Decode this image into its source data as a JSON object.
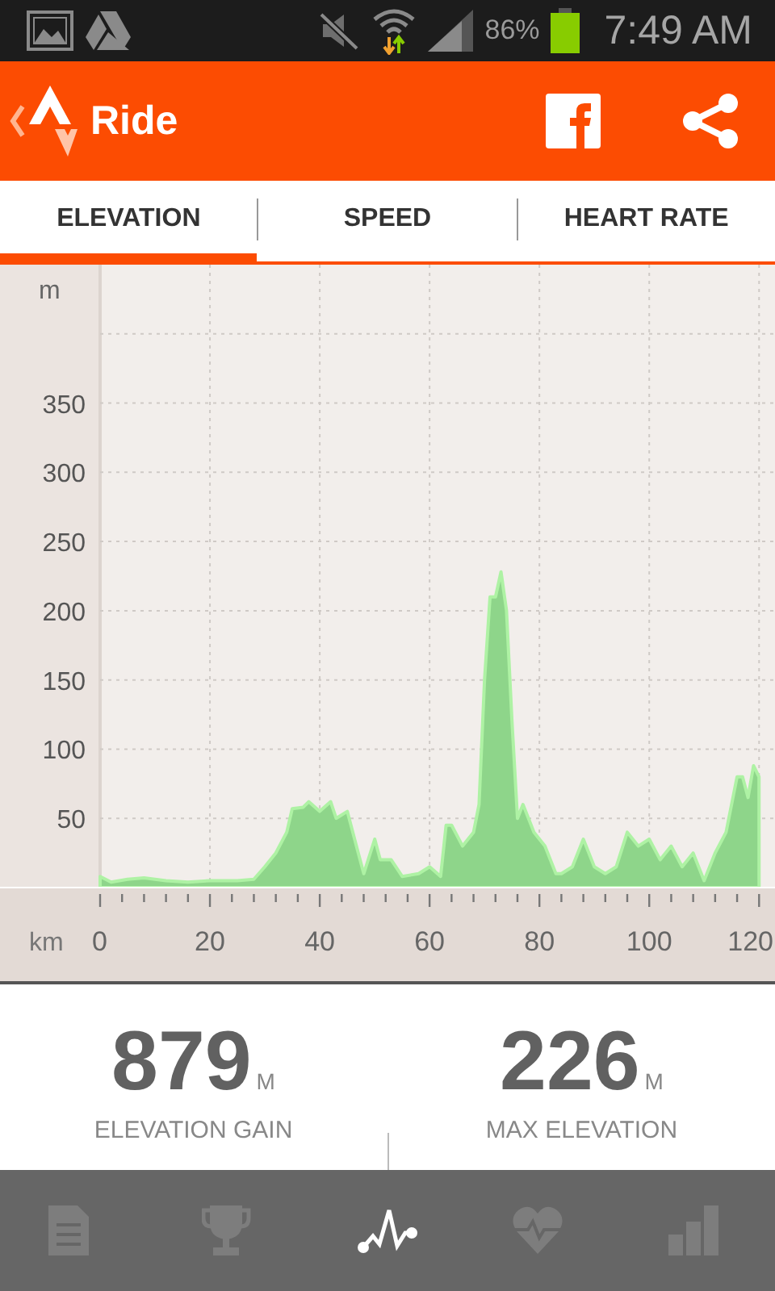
{
  "status_bar": {
    "battery": "86%",
    "time": "7:49 AM"
  },
  "header": {
    "title": "Ride"
  },
  "tabs": [
    {
      "label": "ELEVATION",
      "selected": true
    },
    {
      "label": "SPEED",
      "selected": false
    },
    {
      "label": "HEART RATE",
      "selected": false
    }
  ],
  "chart": {
    "chart_data": {
      "type": "area",
      "xlabel": "km",
      "ylabel": "m",
      "xlim": [
        0,
        122.9
      ],
      "ylim": [
        0,
        450
      ],
      "grid": true,
      "xticks": [
        0,
        20,
        40,
        60,
        80,
        100,
        120
      ],
      "yticks": [
        50,
        100,
        150,
        200,
        250,
        300,
        350
      ],
      "x": [
        0,
        2,
        5,
        8,
        12,
        16,
        20,
        25,
        28,
        30,
        32,
        34,
        35,
        37,
        38,
        40,
        42,
        43,
        45,
        47,
        48,
        50,
        51,
        53,
        55,
        58,
        60,
        62,
        63,
        64,
        66,
        68,
        69,
        70,
        71,
        72,
        73,
        74,
        75,
        76,
        77,
        79,
        81,
        83,
        84,
        86,
        88,
        90,
        92,
        94,
        96,
        98,
        100,
        102,
        104,
        106,
        108,
        110,
        112,
        114,
        116,
        117,
        118,
        119,
        120
      ],
      "series": [
        {
          "color": "#8ed58a",
          "values": [
            8,
            4,
            6,
            7,
            5,
            4,
            5,
            5,
            6,
            15,
            25,
            40,
            57,
            58,
            62,
            55,
            62,
            50,
            55,
            25,
            10,
            35,
            20,
            20,
            8,
            10,
            15,
            8,
            45,
            45,
            30,
            40,
            60,
            150,
            210,
            210,
            228,
            200,
            120,
            50,
            60,
            40,
            30,
            10,
            10,
            15,
            35,
            15,
            10,
            15,
            40,
            30,
            35,
            20,
            30,
            15,
            25,
            5,
            25,
            40,
            80,
            80,
            65,
            88,
            80
          ]
        }
      ]
    }
  },
  "stats": [
    {
      "value": "879",
      "unit": "M",
      "label": "ELEVATION GAIN"
    },
    {
      "value": "226",
      "unit": "M",
      "label": "MAX ELEVATION"
    }
  ],
  "nav": [
    {
      "kind": "document",
      "selected": false
    },
    {
      "kind": "trophy",
      "selected": false
    },
    {
      "kind": "analysis",
      "selected": true
    },
    {
      "kind": "heart",
      "selected": false
    },
    {
      "kind": "bars",
      "selected": false
    }
  ]
}
